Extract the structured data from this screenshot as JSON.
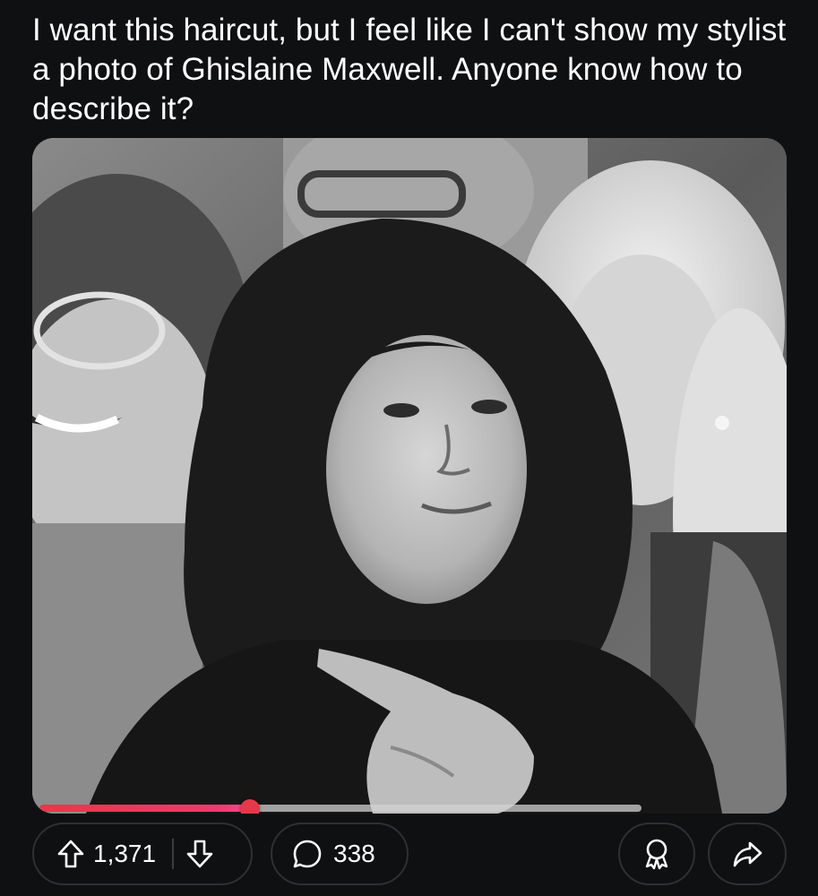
{
  "post": {
    "title": "I want this haircut, but I feel like I can't show my stylist a photo of Ghislaine Maxwell. Anyone know how to describe it?"
  },
  "media": {
    "type": "video",
    "playback_progress_percent": 35
  },
  "actions": {
    "upvote_icon": "arrow-up-outline-icon",
    "upvote_count": "1,371",
    "downvote_icon": "arrow-down-outline-icon",
    "comment_icon": "speech-bubble-icon",
    "comment_count": "338",
    "award_icon": "award-ribbon-icon",
    "share_icon": "share-arrow-icon"
  },
  "colors": {
    "background": "#0f1012",
    "pill_border": "#2e3034",
    "progress_accent": "#e5394a",
    "text": "#ffffff"
  }
}
